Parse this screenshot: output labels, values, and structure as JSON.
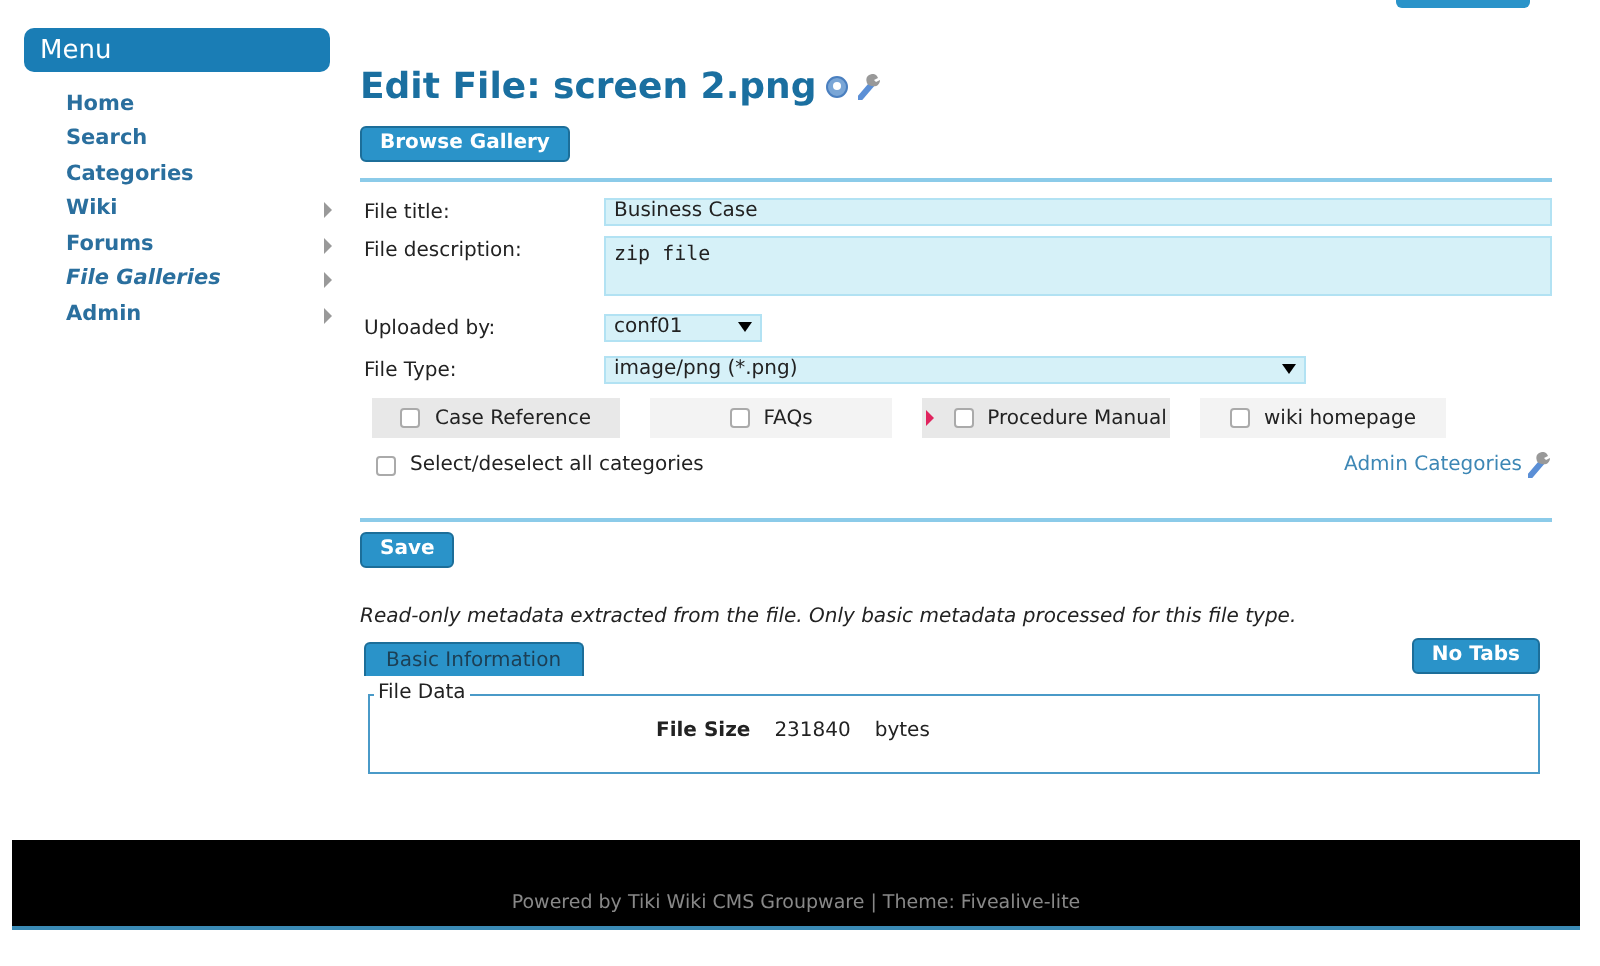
{
  "menu": {
    "title": "Menu",
    "items": [
      {
        "label": "Home",
        "has_submenu": false,
        "selected": false
      },
      {
        "label": "Search",
        "has_submenu": false,
        "selected": false
      },
      {
        "label": "Categories",
        "has_submenu": false,
        "selected": false
      },
      {
        "label": "Wiki",
        "has_submenu": true,
        "selected": false
      },
      {
        "label": "Forums",
        "has_submenu": true,
        "selected": false
      },
      {
        "label": "File Galleries",
        "has_submenu": true,
        "selected": true
      },
      {
        "label": "Admin",
        "has_submenu": true,
        "selected": false
      }
    ]
  },
  "page": {
    "title": "Edit File: screen 2.png",
    "browse_button": "Browse Gallery"
  },
  "form": {
    "fields": [
      {
        "kind": "text",
        "label": "File title:",
        "value": "Business Case"
      },
      {
        "kind": "textarea",
        "label": "File description:",
        "value": "zip file"
      },
      {
        "kind": "select",
        "label": "Uploaded by:",
        "value": "conf01"
      },
      {
        "kind": "wideselect",
        "label": "File Type:",
        "value": "image/png (*.png)"
      }
    ],
    "categories": [
      {
        "label": "Case Reference",
        "checked": false,
        "has_children": false
      },
      {
        "label": "FAQs",
        "checked": false,
        "has_children": false
      },
      {
        "label": "Procedure Manual",
        "checked": false,
        "has_children": true
      },
      {
        "label": "wiki homepage",
        "checked": false,
        "has_children": false
      }
    ],
    "select_all": {
      "label": "Select/deselect all categories",
      "checked": false
    },
    "admin_link": "Admin Categories",
    "save_button": "Save"
  },
  "metadata": {
    "note": "Read-only metadata extracted from the file. Only basic metadata processed for this file type.",
    "tabs": [
      {
        "label": "Basic Information",
        "selected": true
      }
    ],
    "no_tabs_button": "No Tabs",
    "legend": "File Data",
    "rows": [
      {
        "label": "File Size",
        "value": "231840",
        "unit": "bytes"
      }
    ]
  },
  "footer": {
    "prefix": "Powered by",
    "link": "Tiki Wiki CMS Groupware",
    "suffix": "| Theme: Fivealive-lite"
  }
}
